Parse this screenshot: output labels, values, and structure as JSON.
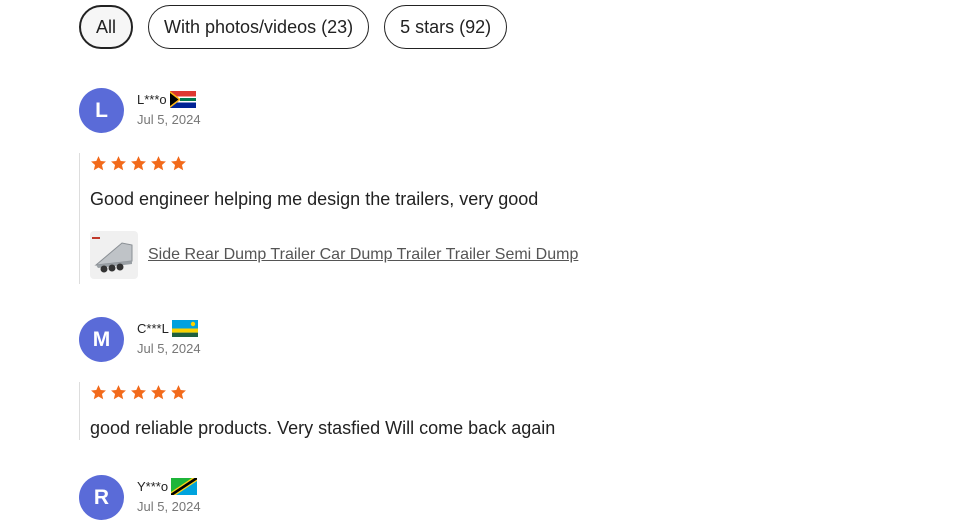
{
  "filters": [
    {
      "label": "All",
      "active": true
    },
    {
      "label": "With photos/videos (23)",
      "active": false
    },
    {
      "label": "5 stars (92)",
      "active": false
    }
  ],
  "reviews": [
    {
      "avatar_letter": "L",
      "name": "L***o",
      "flag": "south-africa-flag",
      "date": "Jul 5, 2024",
      "rating": 5,
      "text": "Good engineer helping me design the trailers, very good",
      "product": "Side Rear Dump Trailer Car Dump Trailer Trailer Semi Dump"
    },
    {
      "avatar_letter": "M",
      "name": "C***L",
      "flag": "rwanda-flag",
      "date": "Jul 5, 2024",
      "rating": 5,
      "text": "good reliable products. Very stasfied Will come back again"
    },
    {
      "avatar_letter": "R",
      "name": "Y***o",
      "flag": "tanzania-flag",
      "date": "Jul 5, 2024"
    }
  ],
  "colors": {
    "star": "#f26a1b",
    "avatar": "#5a6bd8"
  }
}
